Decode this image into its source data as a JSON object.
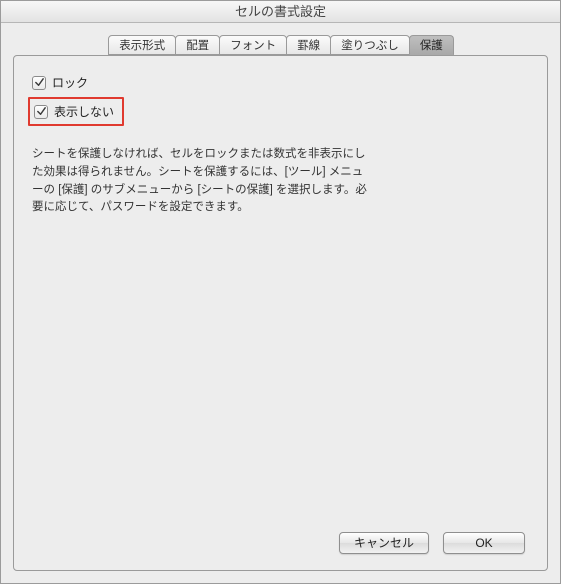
{
  "window": {
    "title": "セルの書式設定"
  },
  "tabs": [
    {
      "label": "表示形式"
    },
    {
      "label": "配置"
    },
    {
      "label": "フォント"
    },
    {
      "label": "罫線"
    },
    {
      "label": "塗りつぶし"
    },
    {
      "label": "保護"
    }
  ],
  "active_tab_index": 5,
  "protection": {
    "lock": {
      "label": "ロック",
      "checked": true
    },
    "hide": {
      "label": "表示しない",
      "checked": true,
      "highlighted": true
    },
    "description": "シートを保護しなければ、セルをロックまたは数式を非表示にした効果は得られません。シートを保護するには、[ツール] メニューの [保護] のサブメニューから [シートの保護] を選択します。必要に応じて、パスワードを設定できます。"
  },
  "buttons": {
    "cancel": "キャンセル",
    "ok": "OK"
  }
}
